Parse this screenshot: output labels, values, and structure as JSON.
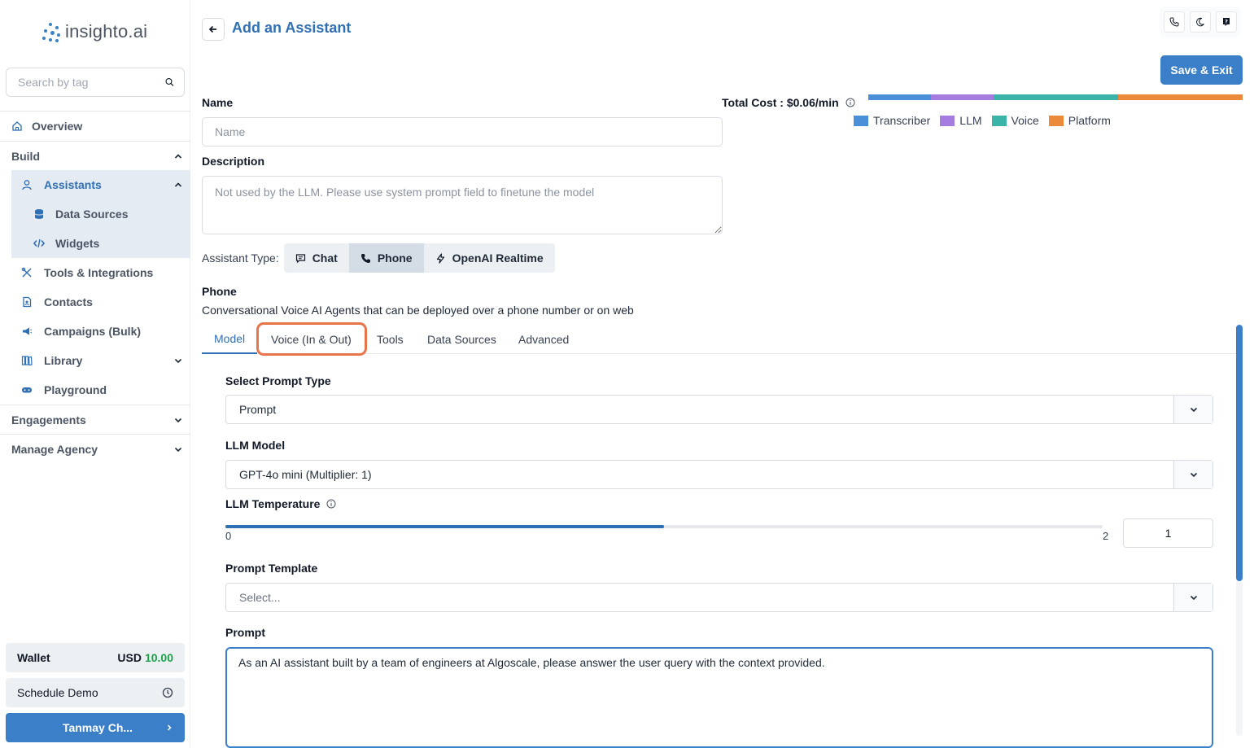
{
  "sidebar": {
    "logo_text": "insighto.ai",
    "search_placeholder": "Search by tag",
    "overview": "Overview",
    "build": "Build",
    "assistants": "Assistants",
    "data_sources": "Data Sources",
    "widgets": "Widgets",
    "tools_integrations": "Tools & Integrations",
    "contacts": "Contacts",
    "campaigns": "Campaigns (Bulk)",
    "library": "Library",
    "playground": "Playground",
    "engagements": "Engagements",
    "manage_agency": "Manage Agency",
    "wallet_label": "Wallet",
    "wallet_currency": "USD",
    "wallet_amount": "10.00",
    "schedule_demo": "Schedule Demo",
    "user_name": "Tanmay Ch..."
  },
  "header": {
    "title": "Add an Assistant",
    "save_exit": "Save & Exit",
    "icons": [
      "phone-icon",
      "moon-icon",
      "help-icon"
    ]
  },
  "cost": {
    "label": "Total Cost : $0.06/min",
    "legend": [
      {
        "name": "Transcriber",
        "color": "#4a90d9",
        "share": 0.167
      },
      {
        "name": "LLM",
        "color": "#a57de0",
        "share": 0.167
      },
      {
        "name": "Voice",
        "color": "#3ab3a8",
        "share": 0.333
      },
      {
        "name": "Platform",
        "color": "#ec8a3c",
        "share": 0.333
      }
    ]
  },
  "form": {
    "name_label": "Name",
    "name_placeholder": "Name",
    "description_label": "Description",
    "description_placeholder": "Not used by the LLM. Please use system prompt field to finetune the model",
    "assistant_type_label": "Assistant Type:",
    "types": [
      "Chat",
      "Phone",
      "OpenAI Realtime"
    ],
    "active_type": "Phone",
    "section_title": "Phone",
    "section_desc": "Conversational Voice AI Agents that can be deployed over a phone number or on web"
  },
  "tabs": [
    "Model",
    "Voice (In & Out)",
    "Tools",
    "Data Sources",
    "Advanced"
  ],
  "model": {
    "prompt_type_label": "Select Prompt Type",
    "prompt_type_value": "Prompt",
    "llm_model_label": "LLM Model",
    "llm_model_value": "GPT-4o mini (Multiplier: 1)",
    "temperature_label": "LLM Temperature",
    "temperature_min": "0",
    "temperature_max": "2",
    "temperature_value": "1",
    "temperature_fraction": 0.5,
    "prompt_template_label": "Prompt Template",
    "prompt_template_placeholder": "Select...",
    "prompt_label": "Prompt",
    "prompt_value": "As an AI assistant built by a team of engineers at Algoscale, please answer the user query with the context provided."
  }
}
